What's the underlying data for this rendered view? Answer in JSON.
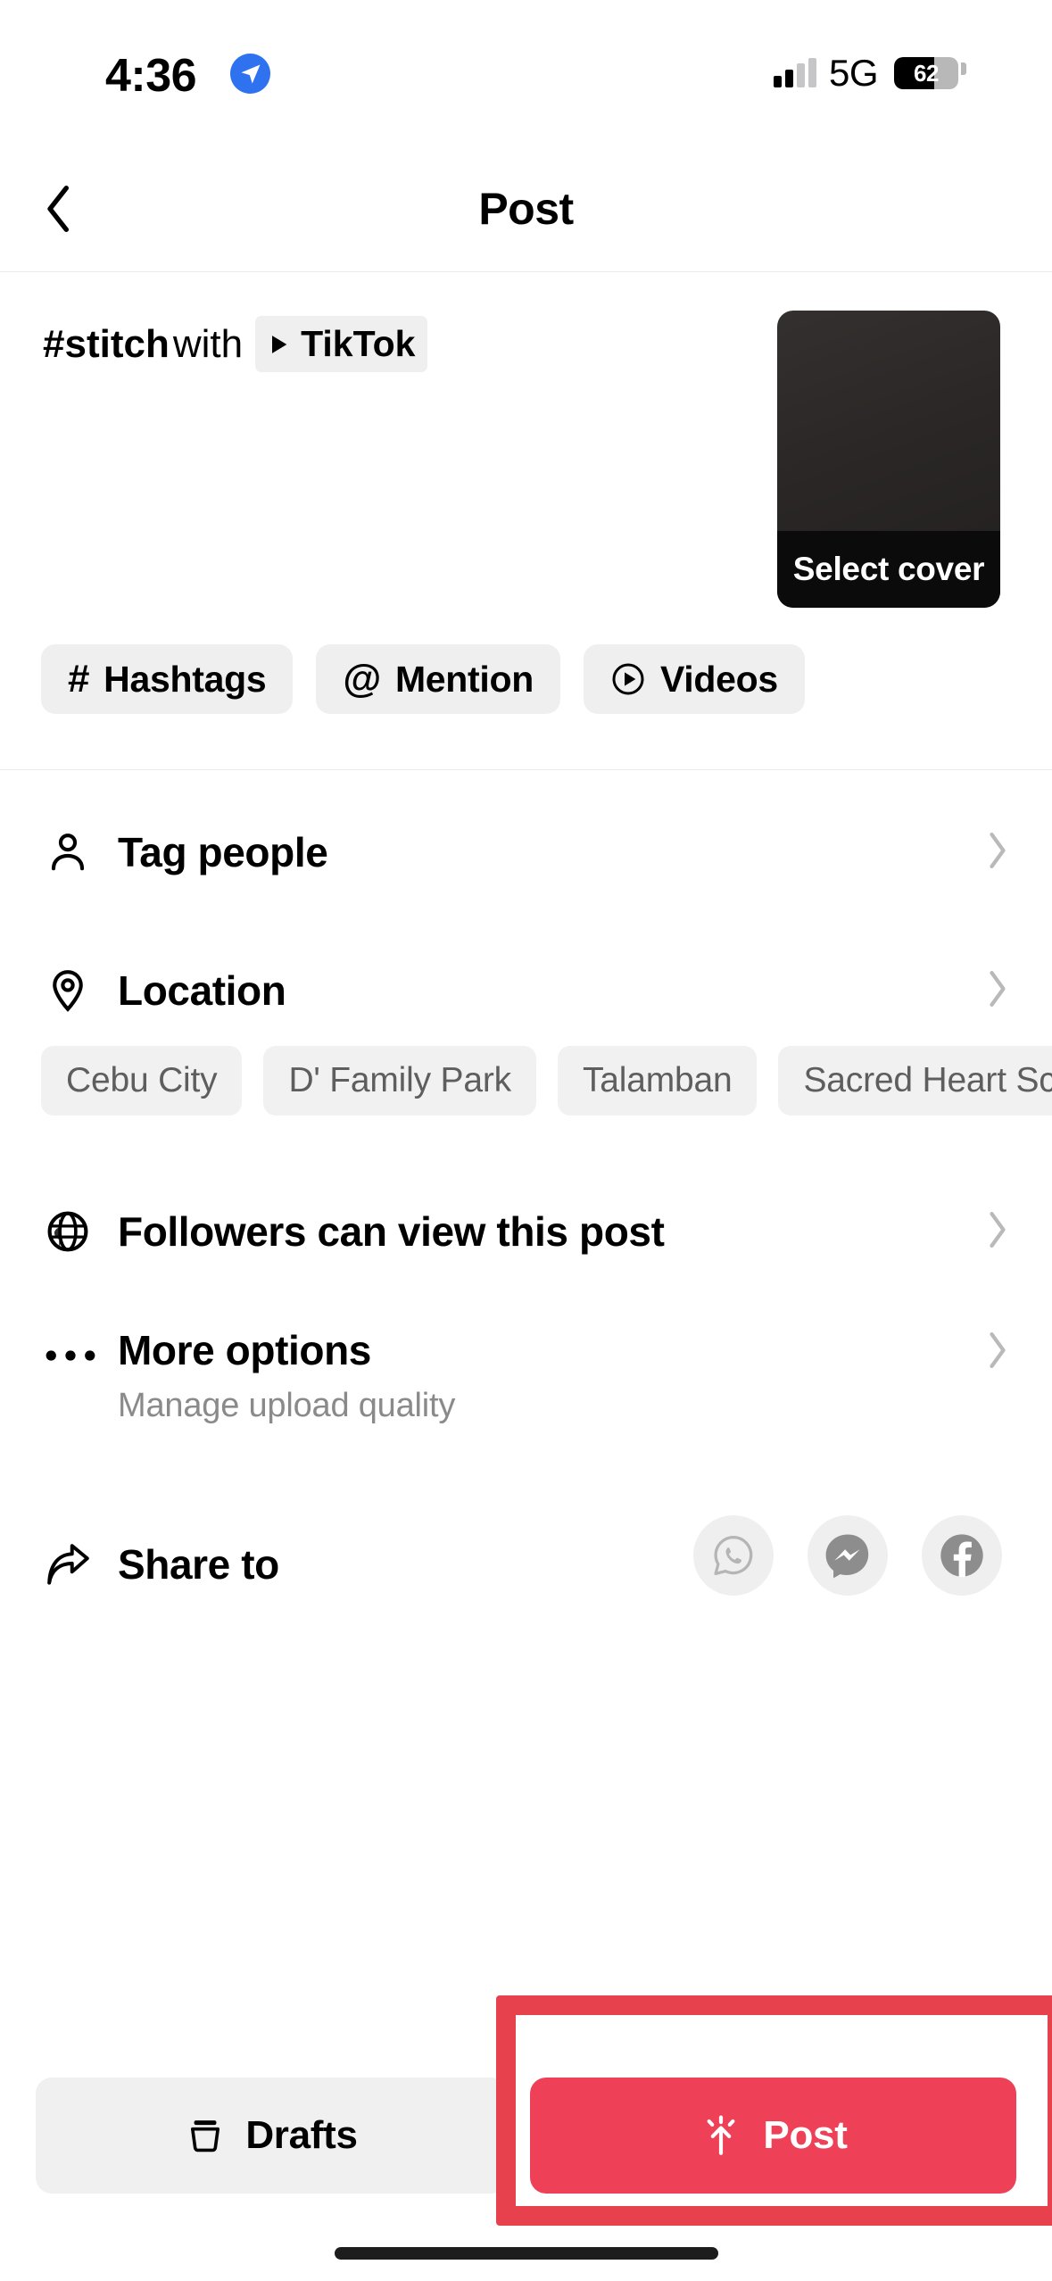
{
  "status_bar": {
    "time": "4:36",
    "location_icon": "location-arrow-icon",
    "network": "5G",
    "battery_percent": "62",
    "signal_icon": "cellular-signal-icon"
  },
  "header": {
    "title": "Post",
    "back_icon": "chevron-left-icon"
  },
  "caption": {
    "prefix": "#stitch",
    "with_word": "with",
    "mention_chip": "TikTok",
    "mention_icon": "play-triangle-icon",
    "cover": {
      "label": "Select cover"
    },
    "chips": [
      {
        "icon": "hashtag-icon",
        "glyph": "#",
        "label": "Hashtags"
      },
      {
        "icon": "at-sign-icon",
        "glyph": "@",
        "label": "Mention"
      },
      {
        "icon": "play-circle-icon",
        "glyph": "",
        "label": "Videos"
      }
    ]
  },
  "rows": {
    "tag_people": {
      "label": "Tag people",
      "icon": "person-icon"
    },
    "location": {
      "label": "Location",
      "icon": "map-pin-icon"
    },
    "location_suggestions": [
      "Cebu City",
      "D' Family Park",
      "Talamban",
      "Sacred Heart Scho"
    ],
    "privacy": {
      "label": "Followers can view this post",
      "icon": "globe-icon"
    },
    "more_options": {
      "label": "More options",
      "subtitle": "Manage upload quality",
      "icon": "ellipsis-icon"
    },
    "share_to": {
      "label": "Share to",
      "icon": "share-arrow-icon",
      "targets": [
        {
          "name": "whatsapp-icon"
        },
        {
          "name": "messenger-icon"
        },
        {
          "name": "facebook-icon"
        }
      ]
    }
  },
  "bottom_bar": {
    "drafts_label": "Drafts",
    "drafts_icon": "drafts-box-icon",
    "post_label": "Post",
    "post_icon": "sparkle-upload-icon"
  },
  "colors": {
    "post_button": "#ee4158",
    "annotation_highlight": "#e8414e",
    "chip_background": "#efefef",
    "secondary_text": "#8a8a8a",
    "divider": "#ececec"
  }
}
